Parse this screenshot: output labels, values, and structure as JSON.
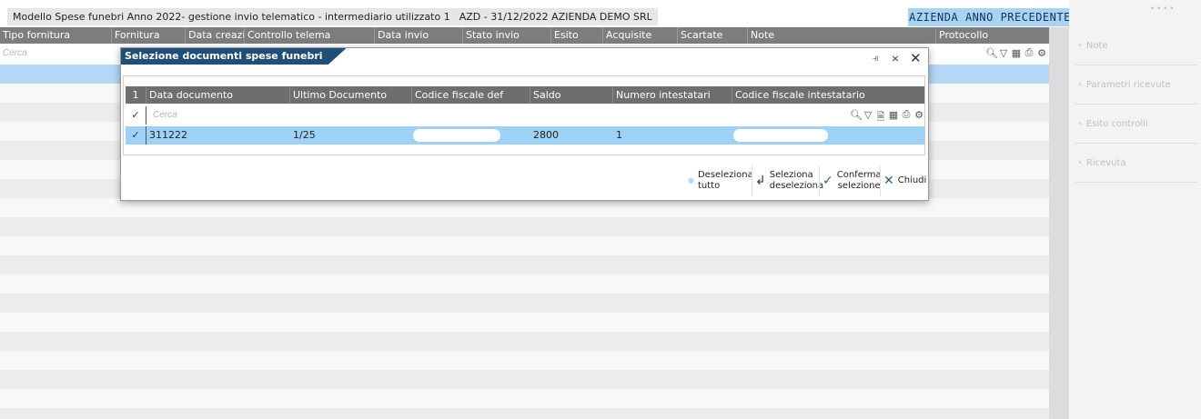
{
  "titlebar": {
    "title": "Modello Spese funebri Anno 2022- gestione invio telematico - intermediario utilizzato 1",
    "company_period": "AZD - 31/12/2022",
    "company_name": "AZIENDA DEMO SRL",
    "prev_year_button": "AZIENDA ANNO PRECEDENTE"
  },
  "grid": {
    "columns": [
      "Tipo fornitura",
      "Fornitura",
      "Data creazio",
      "Controllo telema",
      "Data invio",
      "Stato invio",
      "Esito",
      "Acquisite",
      "Scartate",
      "Note",
      "Protocollo"
    ],
    "search_placeholder": "Cerca"
  },
  "side_panel": {
    "items": [
      "Note",
      "Parametri ricevute",
      "Esito controlli",
      "Ricevuta"
    ]
  },
  "modal": {
    "title": "Selezione documenti spese funebri",
    "columns": [
      "1",
      "Data documento",
      "Ultimo Documento",
      "Codice fiscale def",
      "Saldo",
      "Numero intestatari",
      "Codice fiscale intestatario"
    ],
    "search_placeholder": "Cerca",
    "rows": [
      {
        "data_documento": "311222",
        "ultimo_documento": "1/25",
        "codice_fiscale_def": "",
        "saldo": "2800",
        "numero_intestatari": "1",
        "codice_fiscale_intestatario": ""
      }
    ],
    "footer": {
      "deselect_all_1": "Deseleziona",
      "deselect_all_2": "tutto",
      "toggle_1": "Seleziona",
      "toggle_2": "deseleziona",
      "confirm_1": "Conferma",
      "confirm_2": "selezione",
      "close": "Chiudi"
    }
  },
  "colors": {
    "modal_title_bg": "#1f4e78",
    "selected_row": "#b3d7f4",
    "header_bg": "#7d7d7d",
    "prev_year_bg": "#a9d3f2"
  }
}
